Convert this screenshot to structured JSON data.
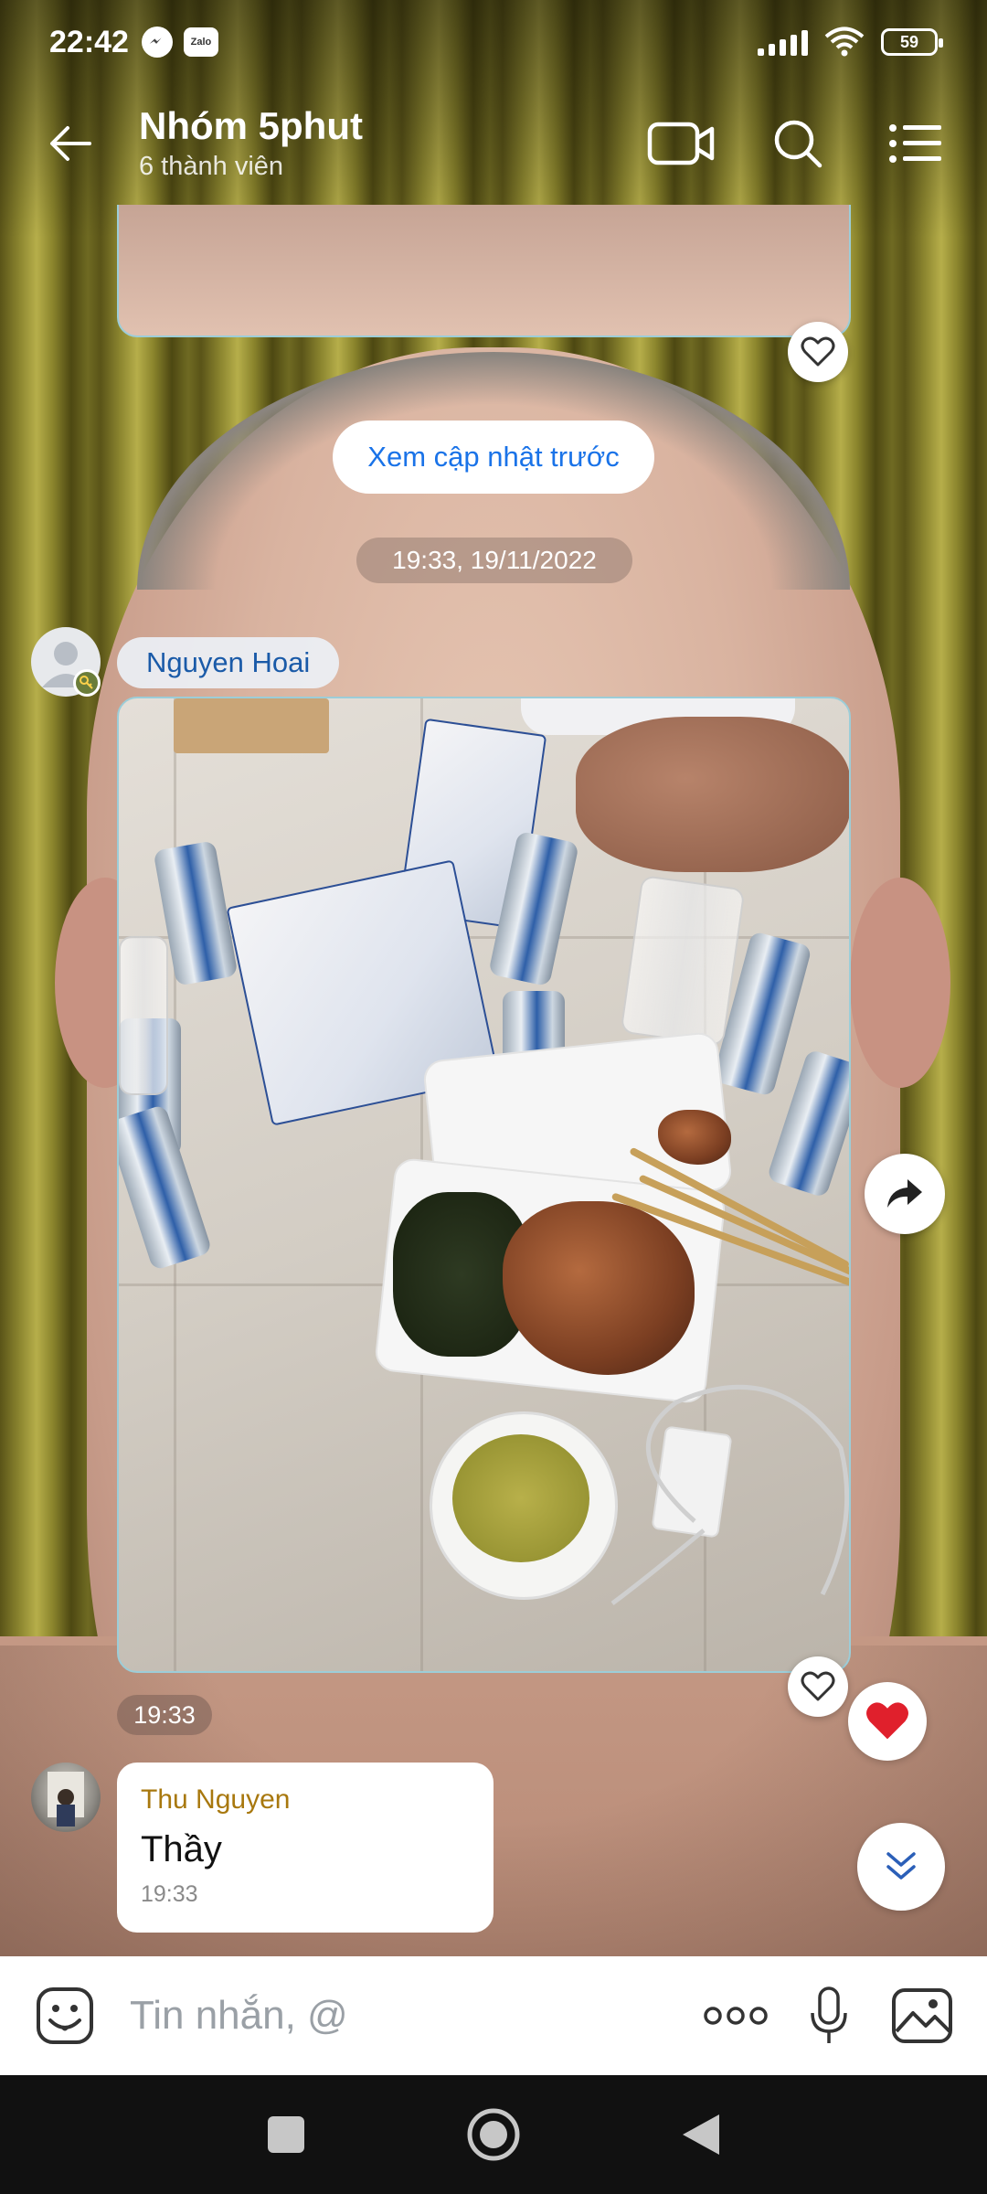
{
  "status_bar": {
    "time": "22:42",
    "notification_icons": [
      "messenger-icon",
      "zalo-icon"
    ],
    "battery_level": "59"
  },
  "header": {
    "title": "Nhóm 5phut",
    "subtitle": "6 thành viên",
    "icons": [
      "back-arrow-icon",
      "video-call-icon",
      "search-icon",
      "menu-list-icon"
    ]
  },
  "chat": {
    "load_more_label": "Xem cập nhật trước",
    "date_separator": "19:33, 19/11/2022",
    "messages": [
      {
        "type": "photo",
        "sender": "Nguyen Hoai",
        "time": "19:33",
        "reaction": "heart"
      },
      {
        "type": "text",
        "sender": "Thu Nguyen",
        "text": "Thầy",
        "time": "19:33"
      }
    ]
  },
  "composer": {
    "placeholder": "Tin nhắn, @",
    "icons": [
      "emoji-icon",
      "more-icon",
      "microphone-icon",
      "image-icon"
    ]
  },
  "colors": {
    "accent_blue": "#1a73e8",
    "sender_name_blue": "#1a5aa8",
    "sender_name_gold": "#a8780e",
    "reaction_red": "#e0202c",
    "bubble_border": "#9ccdd8"
  }
}
